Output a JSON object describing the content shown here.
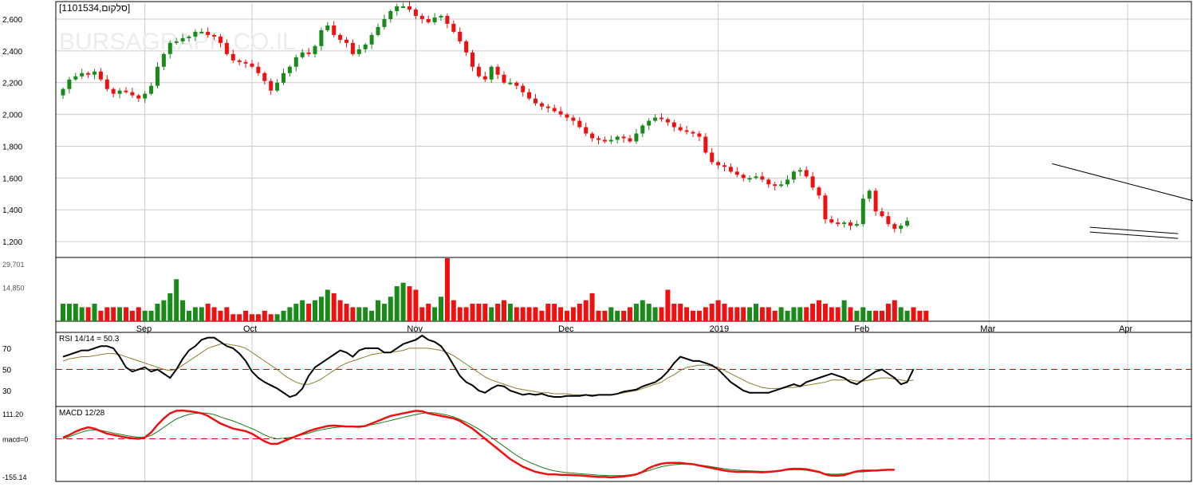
{
  "header": {
    "symbol_label": "[1101534,סלקום]",
    "watermark": "BURSAGRAPH.CO.IL"
  },
  "colors": {
    "up": "#1a8a1a",
    "down": "#ee1111",
    "grid": "#cccccc",
    "reference": "#dd0000",
    "rsi": "#000000",
    "rsi_signal": "#8b7d2a",
    "macd": "#ee1111",
    "macd_signal": "#1a7a1a",
    "trendline": "#000000"
  },
  "chart_data": [
    {
      "type": "candlestick",
      "panel": "price",
      "ylim": [
        1100,
        2700
      ],
      "y_ticks": [
        1200,
        1400,
        1600,
        1800,
        2000,
        2200,
        2400,
        2600
      ],
      "y_tick_labels": [
        "1,200",
        "1,400",
        "1,600",
        "1,800",
        "2,000",
        "2,200",
        "2,400",
        "2,600"
      ],
      "x_labels": [
        {
          "label": "Sep",
          "day": 13
        },
        {
          "label": "Oct",
          "day": 30
        },
        {
          "label": "Nov",
          "day": 56
        },
        {
          "label": "Dec",
          "day": 80
        },
        {
          "label": "2019",
          "day": 104
        },
        {
          "label": "Feb",
          "day": 127
        },
        {
          "label": "Mar",
          "day": 147
        },
        {
          "label": "Apr",
          "day": 169
        }
      ],
      "close": [
        2160,
        2220,
        2240,
        2260,
        2250,
        2270,
        2220,
        2160,
        2130,
        2150,
        2140,
        2120,
        2100,
        2130,
        2180,
        2300,
        2380,
        2450,
        2460,
        2480,
        2490,
        2520,
        2520,
        2500,
        2490,
        2450,
        2380,
        2340,
        2330,
        2320,
        2300,
        2260,
        2210,
        2150,
        2200,
        2260,
        2300,
        2360,
        2390,
        2380,
        2430,
        2530,
        2560,
        2500,
        2470,
        2450,
        2380,
        2410,
        2440,
        2500,
        2550,
        2600,
        2650,
        2680,
        2680,
        2660,
        2620,
        2600,
        2580,
        2610,
        2620,
        2570,
        2520,
        2460,
        2390,
        2300,
        2240,
        2220,
        2300,
        2250,
        2200,
        2200,
        2180,
        2140,
        2100,
        2070,
        2050,
        2040,
        2020,
        2000,
        1980,
        1960,
        1920,
        1880,
        1850,
        1840,
        1830,
        1840,
        1860,
        1850,
        1830,
        1880,
        1930,
        1960,
        1980,
        1970,
        1950,
        1920,
        1900,
        1890,
        1880,
        1860,
        1760,
        1700,
        1680,
        1670,
        1640,
        1620,
        1600,
        1600,
        1610,
        1590,
        1560,
        1550,
        1560,
        1590,
        1640,
        1650,
        1610,
        1540,
        1490,
        1340,
        1320,
        1310,
        1320,
        1300,
        1310,
        1470,
        1520,
        1390,
        1360,
        1310,
        1280,
        1300,
        1330
      ],
      "volume_ylim": [
        0,
        29701
      ],
      "volume_tick_labels": [
        "29,701",
        "14,850"
      ],
      "volume_hint": [
        2.5,
        2.5,
        2.5,
        2.0,
        2.0,
        2.5,
        1.5,
        2.0,
        2.0,
        2.0,
        2.0,
        1.5,
        2.0,
        1.5,
        1.5,
        2.5,
        3.0,
        4.0,
        6.0,
        3.0,
        1.5,
        2.0,
        2.0,
        2.5,
        2.0,
        1.5,
        2.0,
        1.0,
        1.0,
        1.5,
        1.0,
        1.0,
        1.5,
        1.0,
        1.0,
        1.5,
        2.0,
        2.5,
        3.0,
        2.5,
        3.0,
        3.5,
        4.5,
        4.0,
        3.0,
        2.5,
        2.0,
        2.0,
        2.0,
        1.5,
        3.0,
        2.5,
        3.5,
        5.0,
        5.5,
        5.0,
        4.5,
        2.0,
        2.5,
        2.0,
        3.5,
        9.0,
        3.0,
        2.0,
        2.0,
        2.5,
        2.5,
        2.5,
        2.0,
        2.5,
        3.0,
        2.5,
        2.0,
        2.0,
        2.0,
        2.0,
        1.5,
        2.5,
        2.5,
        2.0,
        1.5,
        2.0,
        2.5,
        3.0,
        4.0,
        1.5,
        1.5,
        2.0,
        1.5,
        1.5,
        2.0,
        2.5,
        3.0,
        2.5,
        2.0,
        2.0,
        4.5,
        2.5,
        2.5,
        2.0,
        1.5,
        1.5,
        2.0,
        2.5,
        3.0,
        2.5,
        2.0,
        2.0,
        2.0,
        2.0,
        2.5,
        2.0,
        2.0,
        1.5,
        2.0,
        1.5,
        2.0,
        2.0,
        2.0,
        2.5,
        3.0,
        2.5,
        2.0,
        2.0,
        3.0,
        2.0,
        1.5,
        2.0,
        1.5,
        1.5,
        1.5,
        2.5,
        3.0,
        2.0,
        1.5,
        2.0,
        1.5,
        1.5
      ],
      "trendlines": [
        {
          "from_day": 157,
          "from_price": 1690,
          "to_day": 181,
          "to_price": 1440
        },
        {
          "from_day": 163,
          "from_price": 1290,
          "to_day": 177,
          "to_price": 1250
        },
        {
          "from_day": 163,
          "from_price": 1260,
          "to_day": 177,
          "to_price": 1220
        }
      ]
    },
    {
      "type": "line",
      "panel": "rsi",
      "title": "RSI 14/14 = 50.3",
      "ylim": [
        15,
        85
      ],
      "y_ticks": [
        30,
        50,
        70
      ],
      "y_tick_labels": [
        "30",
        "50",
        "70"
      ],
      "reference_line": 50,
      "series": [
        {
          "values": [
            62,
            64,
            66,
            68,
            68,
            70,
            72,
            72,
            70,
            62,
            52,
            48,
            50,
            52,
            48,
            50,
            46,
            42,
            50,
            60,
            68,
            72,
            78,
            80,
            80,
            76,
            72,
            70,
            65,
            58,
            48,
            42,
            38,
            35,
            32,
            28,
            24,
            26,
            32,
            44,
            52,
            56,
            60,
            64,
            68,
            66,
            62,
            68,
            70,
            70,
            70,
            66,
            66,
            70,
            74,
            76,
            78,
            82,
            78,
            76,
            72,
            64,
            54,
            44,
            38,
            35,
            30,
            28,
            32,
            35,
            34,
            30,
            28,
            26,
            27,
            26,
            27,
            25,
            24,
            24,
            25,
            25,
            25,
            26,
            25,
            26,
            26,
            26,
            27,
            29,
            30,
            31,
            34,
            36,
            38,
            42,
            48,
            56,
            62,
            60,
            58,
            58,
            56,
            54,
            50,
            44,
            38,
            34,
            30,
            28,
            28,
            28,
            28,
            30,
            32,
            34,
            36,
            34,
            38,
            40,
            42,
            44,
            46,
            44,
            42,
            38,
            36,
            40,
            44,
            48,
            50,
            46,
            42,
            36,
            38,
            50.3
          ]
        },
        {
          "values": [
            58,
            60,
            61,
            62,
            62,
            63,
            64,
            65,
            65,
            64,
            62,
            60,
            58,
            56,
            54,
            52,
            50,
            49,
            50,
            54,
            58,
            62,
            66,
            70,
            72,
            74,
            74,
            73,
            72,
            70,
            66,
            62,
            58,
            54,
            50,
            45,
            41,
            38,
            36,
            36,
            38,
            41,
            45,
            49,
            53,
            56,
            58,
            60,
            62,
            64,
            65,
            66,
            66,
            67,
            68,
            70,
            70,
            70,
            70,
            69,
            68,
            66,
            63,
            59,
            55,
            51,
            47,
            43,
            40,
            38,
            36,
            34,
            32,
            31,
            30,
            29,
            28,
            28,
            27,
            27,
            27,
            26,
            26,
            26,
            26,
            26,
            26,
            26,
            27,
            28,
            29,
            30,
            32,
            34,
            36,
            38,
            42,
            45,
            49,
            52,
            53,
            54,
            54,
            53,
            52,
            49,
            46,
            43,
            40,
            37,
            35,
            33,
            32,
            32,
            32,
            33,
            33,
            34,
            35,
            36,
            37,
            38,
            40,
            40,
            40,
            40,
            39,
            39,
            40,
            41,
            42,
            42,
            41,
            40,
            39,
            40
          ]
        }
      ]
    },
    {
      "type": "line",
      "panel": "macd",
      "title": "MACD 12/28",
      "ylim": [
        -155.14,
        111.2
      ],
      "y_tick_labels": [
        "111.20",
        "macd=0",
        "-155.14"
      ],
      "reference_line": 0,
      "series": [
        {
          "values": [
            5,
            15,
            28,
            38,
            45,
            40,
            30,
            20,
            15,
            10,
            5,
            2,
            0,
            5,
            25,
            55,
            80,
            100,
            110,
            111,
            108,
            105,
            100,
            90,
            75,
            60,
            50,
            40,
            35,
            30,
            20,
            5,
            -10,
            -20,
            -20,
            -10,
            0,
            10,
            20,
            30,
            38,
            44,
            50,
            52,
            50,
            48,
            48,
            47,
            50,
            60,
            70,
            80,
            90,
            95,
            100,
            105,
            110,
            108,
            100,
            95,
            90,
            85,
            80,
            70,
            55,
            40,
            20,
            0,
            -20,
            -40,
            -60,
            -80,
            -95,
            -110,
            -120,
            -130,
            -135,
            -140,
            -140,
            -142,
            -142,
            -143,
            -144,
            -146,
            -148,
            -150,
            -150,
            -152,
            -150,
            -148,
            -145,
            -140,
            -130,
            -115,
            -105,
            -98,
            -95,
            -95,
            -95,
            -98,
            -100,
            -105,
            -110,
            -115,
            -120,
            -125,
            -128,
            -130,
            -130,
            -130,
            -131,
            -132,
            -130,
            -128,
            -125,
            -120,
            -118,
            -118,
            -120,
            -125,
            -130,
            -140,
            -145,
            -145,
            -143,
            -135,
            -128,
            -125,
            -125,
            -125,
            -123,
            -122,
            -122
          ]
        },
        {
          "values": [
            0,
            8,
            18,
            26,
            33,
            35,
            33,
            28,
            22,
            18,
            13,
            9,
            6,
            6,
            13,
            28,
            45,
            62,
            78,
            88,
            96,
            100,
            102,
            100,
            95,
            86,
            78,
            70,
            60,
            50,
            40,
            28,
            15,
            5,
            0,
            2,
            5,
            10,
            16,
            22,
            30,
            35,
            40,
            44,
            46,
            47,
            48,
            50,
            52,
            55,
            60,
            66,
            72,
            78,
            84,
            90,
            95,
            100,
            103,
            102,
            98,
            93,
            86,
            76,
            65,
            52,
            38,
            22,
            5,
            -12,
            -30,
            -48,
            -65,
            -80,
            -92,
            -102,
            -112,
            -120,
            -126,
            -130,
            -133,
            -135,
            -137,
            -139,
            -141,
            -143,
            -144,
            -145,
            -145,
            -144,
            -142,
            -138,
            -132,
            -125,
            -117,
            -110,
            -105,
            -102,
            -100,
            -100,
            -101,
            -103,
            -106,
            -110,
            -114,
            -118,
            -121,
            -123,
            -125,
            -126,
            -127,
            -128,
            -128,
            -127,
            -125,
            -123,
            -122,
            -122,
            -124,
            -128,
            -133,
            -137,
            -139,
            -139,
            -137,
            -134,
            -131,
            -130,
            -128,
            -126,
            -125,
            -124
          ]
        }
      ]
    }
  ]
}
